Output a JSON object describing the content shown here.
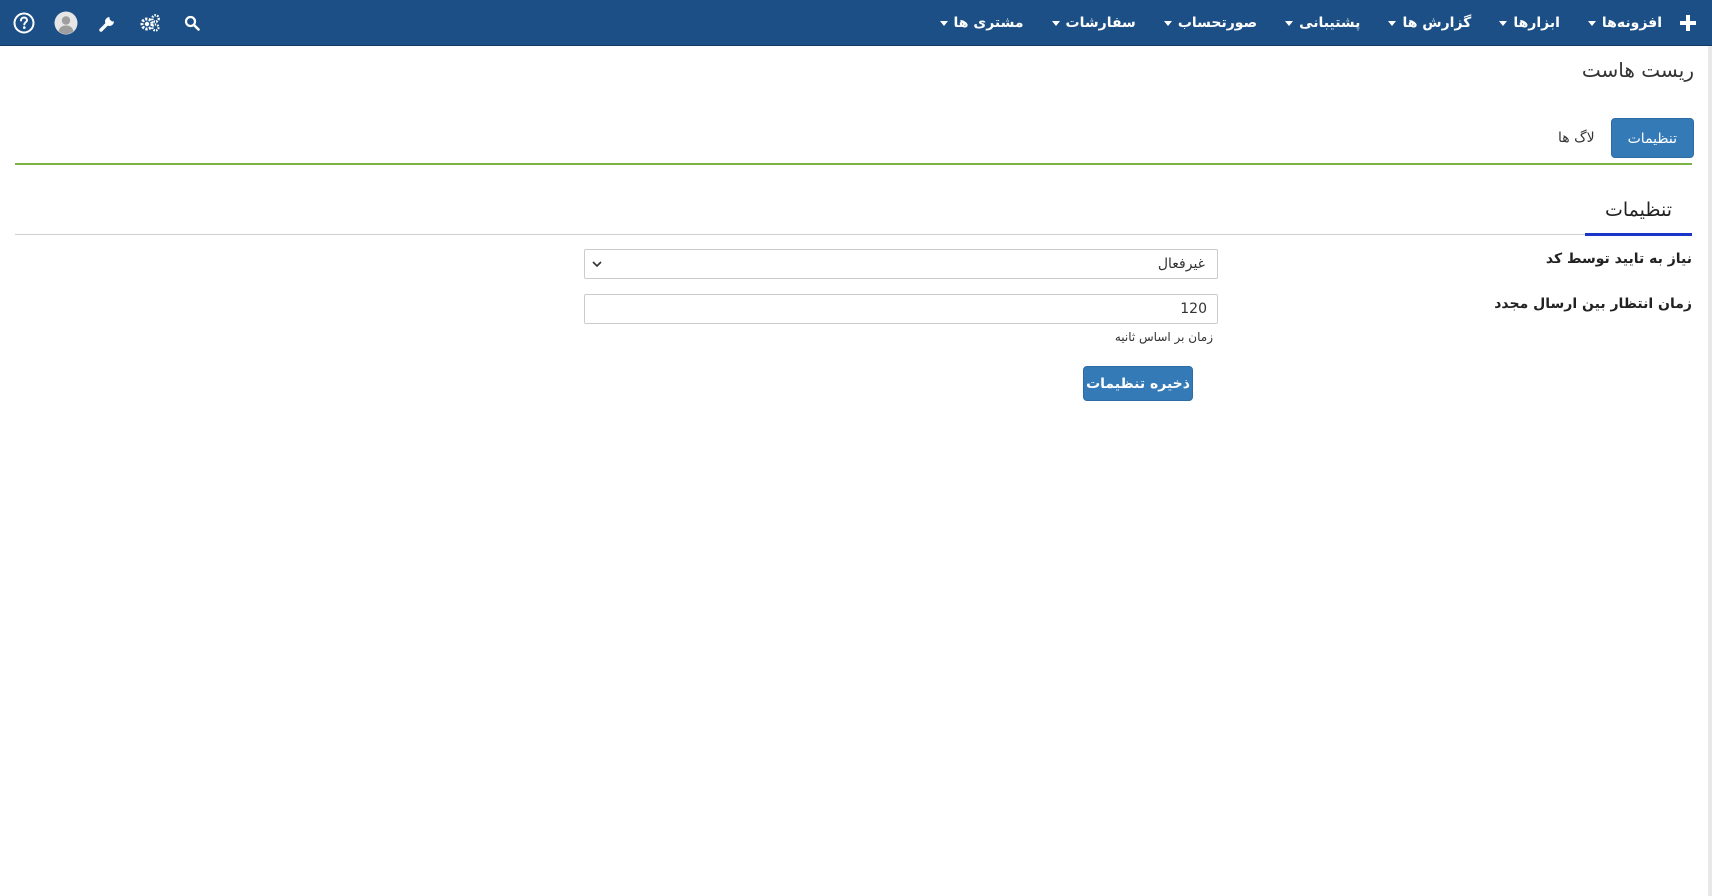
{
  "navbar": {
    "add_icon": "plus-icon",
    "menu": [
      {
        "label": "مشتری ها",
        "has_caret": true
      },
      {
        "label": "سفارشات",
        "has_caret": true
      },
      {
        "label": "صورتحساب",
        "has_caret": true
      },
      {
        "label": "پشتیبانی",
        "has_caret": true
      },
      {
        "label": "گزارش ها",
        "has_caret": true
      },
      {
        "label": "ابزارها",
        "has_caret": true
      },
      {
        "label": "افزونه‌ها",
        "has_caret": true
      }
    ],
    "icons": [
      "help-icon",
      "user-avatar-icon",
      "wrench-icon",
      "cogs-icon",
      "search-icon"
    ],
    "bg_color": "#1b4f86"
  },
  "page": {
    "title": "ریست هاست",
    "tabs": [
      {
        "label": "تنظیمات",
        "active": true
      },
      {
        "label": "لاگ ها",
        "active": false
      }
    ],
    "section_title": "تنظیمات"
  },
  "form": {
    "code_verification": {
      "label": "نیاز به تایید توسط کد",
      "value": "غیرفعال"
    },
    "resend_wait": {
      "label": "زمان انتظار بین ارسال مجدد",
      "value": "120",
      "help": "زمان بر اساس ثانیه"
    },
    "save_label": "ذخیره تنظیمات"
  },
  "colors": {
    "primary": "#337ab7",
    "accent_line": "#7cb342",
    "section_underline": "#1a35c7"
  }
}
